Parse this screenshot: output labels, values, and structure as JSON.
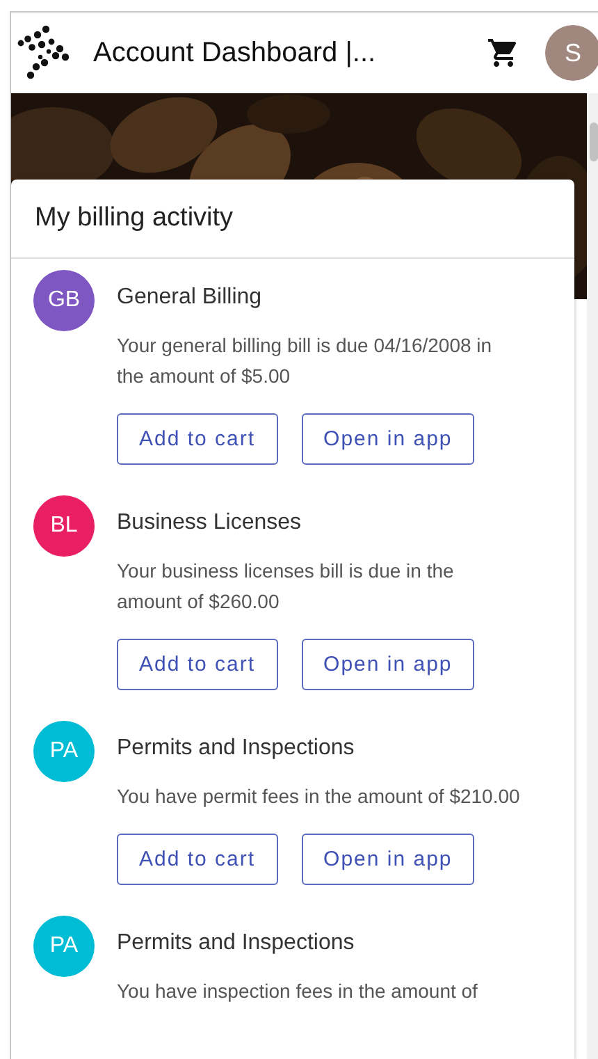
{
  "header": {
    "title": "Account Dashboard |...",
    "avatar": "S"
  },
  "card": {
    "title": "My billing activity"
  },
  "items": [
    {
      "initials": "GB",
      "color": "#7e57c2",
      "title": "General Billing",
      "text": "Your general billing bill is due 04/16/2008 in the amount of $5.00",
      "buttons": [
        "Add to cart",
        "Open in app"
      ]
    },
    {
      "initials": "BL",
      "color": "#e91e63",
      "title": "Business Licenses",
      "text": "Your business licenses bill is due in the amount of $260.00",
      "buttons": [
        "Add to cart",
        "Open in app"
      ]
    },
    {
      "initials": "PA",
      "color": "#00bcd4",
      "title": "Permits and Inspections",
      "text": "You have permit fees in the amount of $210.00",
      "buttons": [
        "Add to cart",
        "Open in app"
      ]
    },
    {
      "initials": "PA",
      "color": "#00bcd4",
      "title": "Permits and Inspections",
      "text": "You have inspection fees in the amount of"
    }
  ]
}
